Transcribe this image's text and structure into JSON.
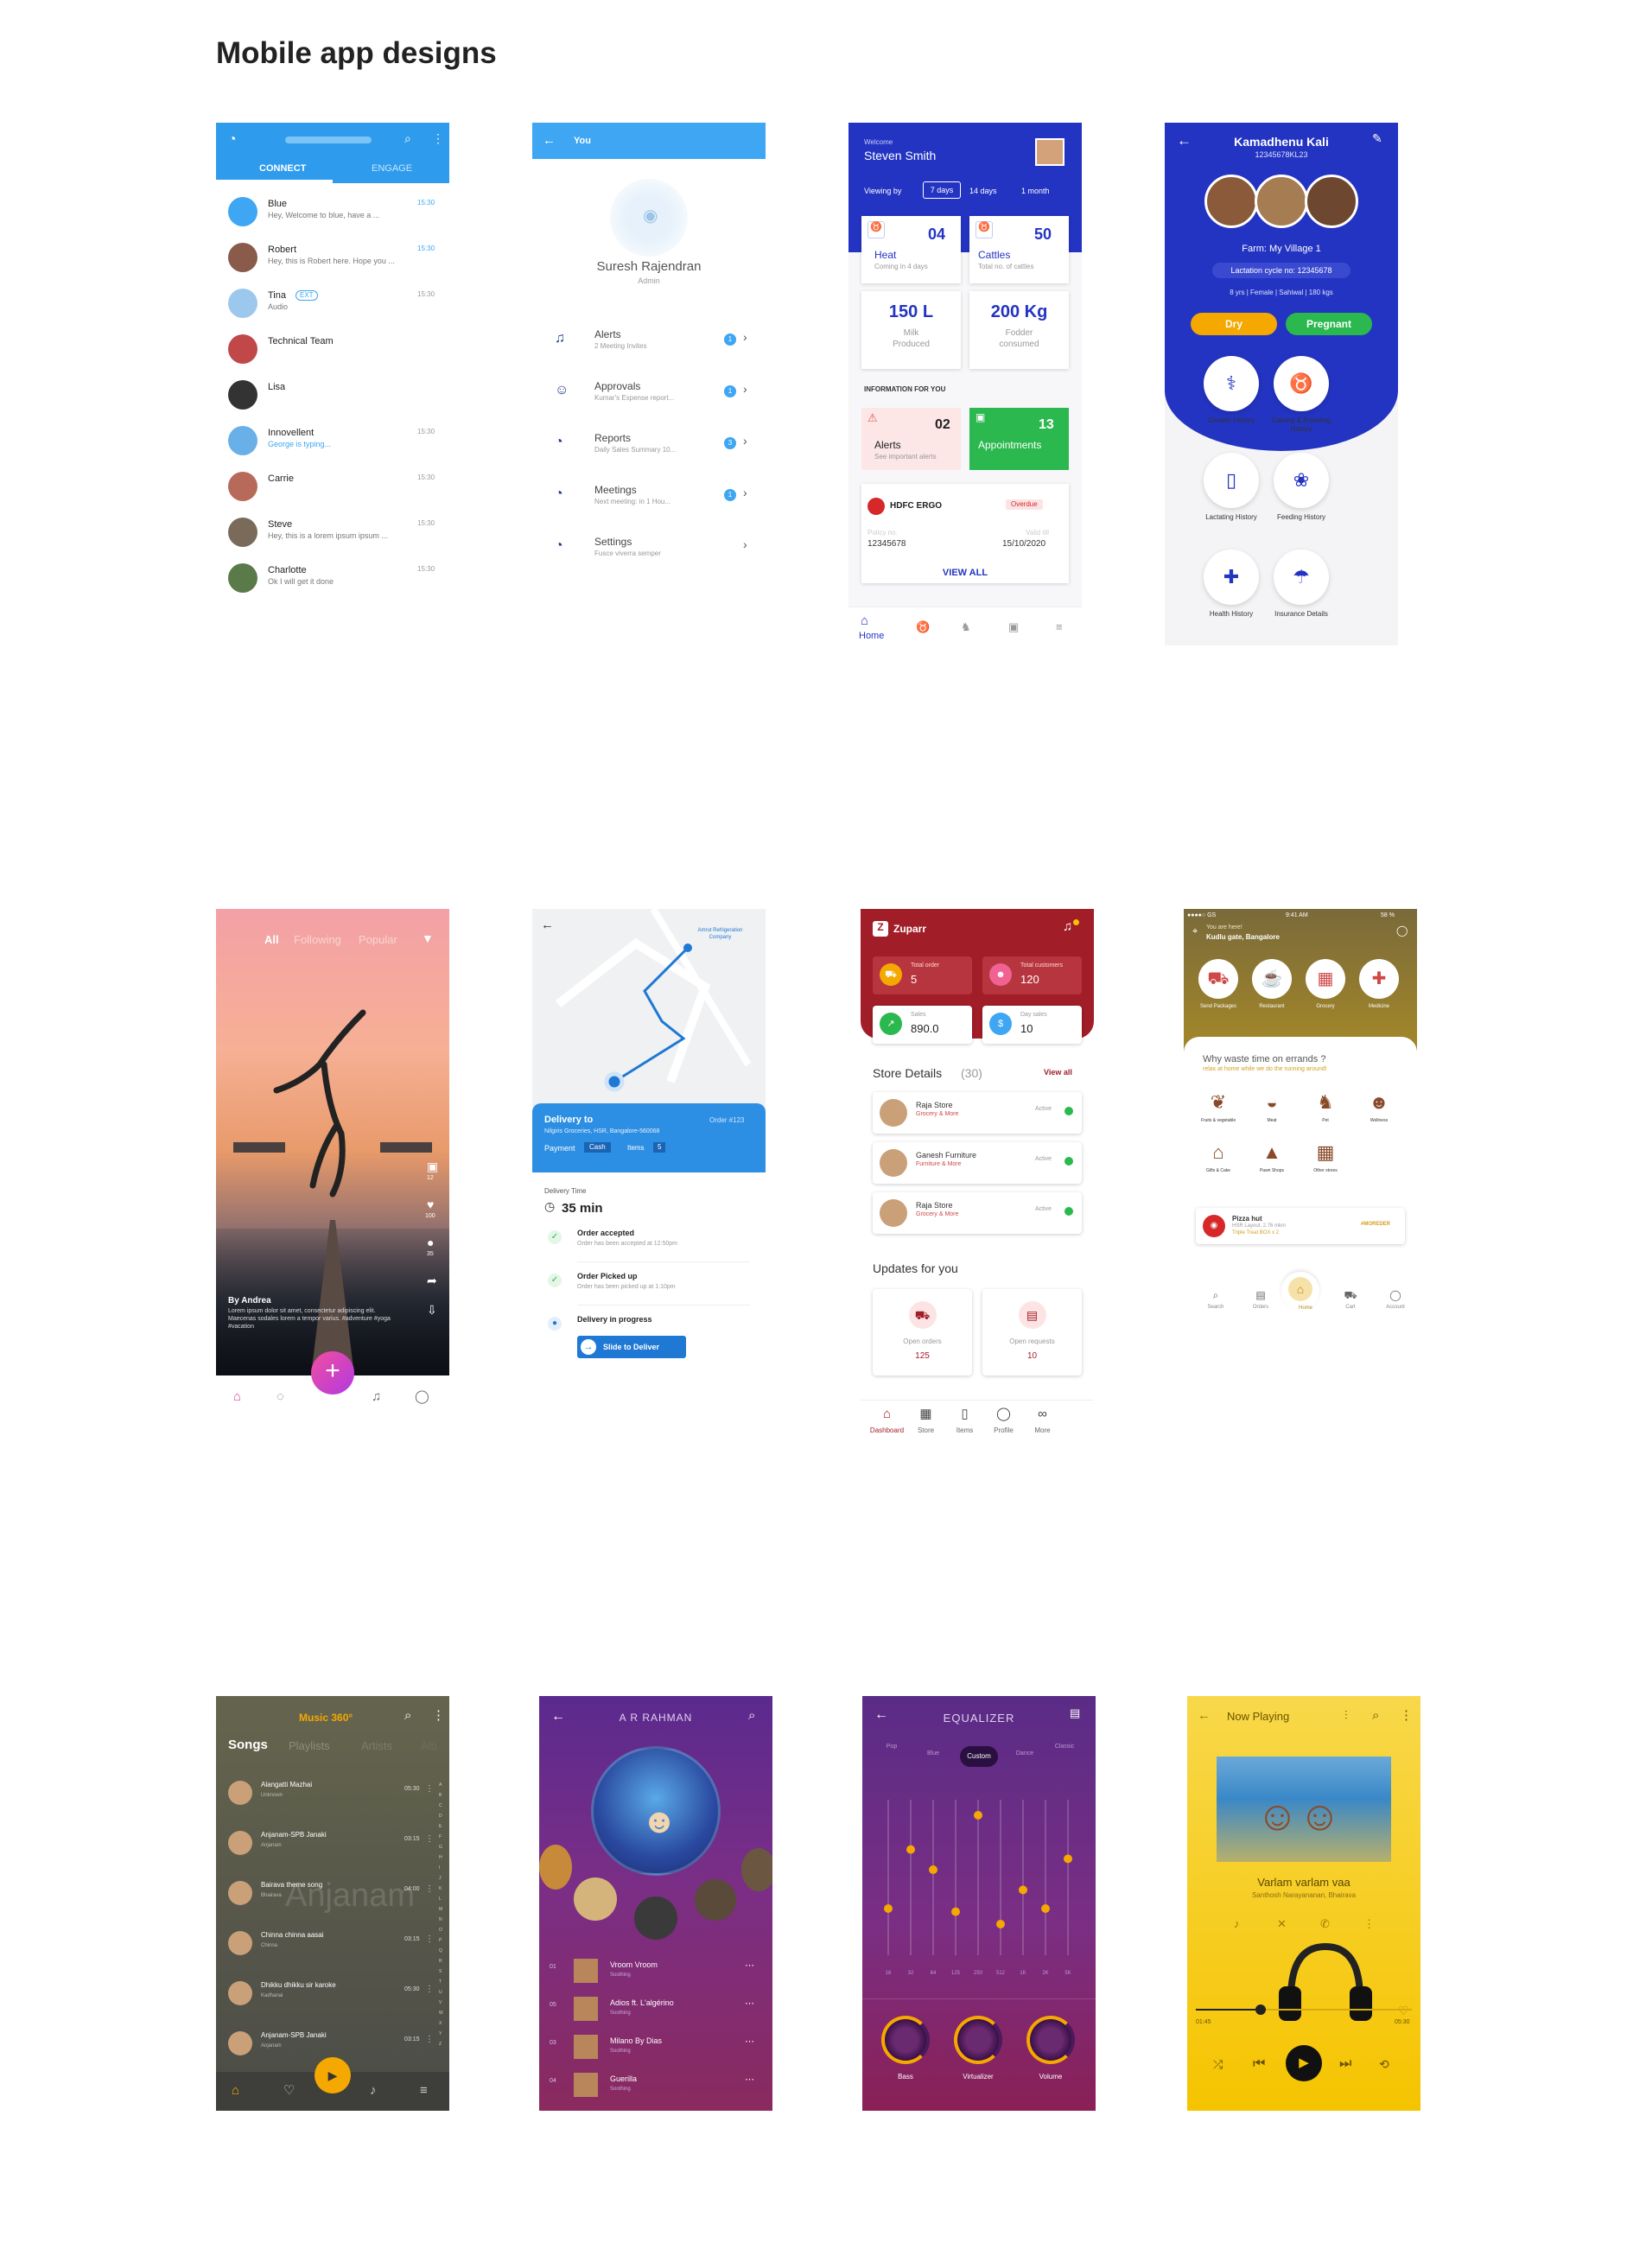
{
  "page_title": "Mobile app designs",
  "s1": {
    "tabs": [
      "CONNECT",
      "ENGAGE"
    ],
    "chats": [
      {
        "name": "Blue",
        "msg": "Hey, Welcome to blue, have a ...",
        "time": "15:30"
      },
      {
        "name": "Robert",
        "msg": "Hey, this is Robert here. Hope you ...",
        "time": "15:30"
      },
      {
        "name": "Tina",
        "tag": "EXT",
        "msg": "Audio",
        "time": "15:30"
      },
      {
        "name": "Technical Team",
        "msg": "",
        "time": ""
      },
      {
        "name": "Lisa",
        "msg": "",
        "time": ""
      },
      {
        "name": "Innovellent",
        "msg": "George is typing...",
        "time": "15:30"
      },
      {
        "name": "Carrie",
        "msg": "",
        "time": "15:30"
      },
      {
        "name": "Steve",
        "msg": "Hey, this is a lorem ipsum ipsum ...",
        "time": "15:30"
      },
      {
        "name": "Charlotte",
        "msg": "Ok I will get it done",
        "time": "15:30"
      }
    ]
  },
  "s2": {
    "header": "You",
    "name": "Suresh Rajendran",
    "role": "Admin",
    "items": [
      {
        "title": "Alerts",
        "sub": "2 Meeting Invites",
        "badge": "1"
      },
      {
        "title": "Approvals",
        "sub": "Kumar's Expense report...",
        "badge": "1"
      },
      {
        "title": "Reports",
        "sub": "Daily Sales Summary 10...",
        "badge": "3"
      },
      {
        "title": "Meetings",
        "sub": "Next meeting: in 1 Hou...",
        "badge": "1"
      },
      {
        "title": "Settings",
        "sub": "Fusce viverra semper",
        "badge": ""
      }
    ]
  },
  "s3": {
    "welcome": "Welcome",
    "user": "Steven Smith",
    "viewing": "Viewing by",
    "filters": [
      "7 days",
      "14 days",
      "1 month"
    ],
    "heat_value": "04",
    "heat_label": "Heat",
    "heat_sub": "Coming in 4 days",
    "cattle_value": "50",
    "cattle_label": "Cattles",
    "cattle_sub": "Total no. of cattles",
    "milk_value": "150 L",
    "milk_l1": "Milk",
    "milk_l2": "Produced",
    "fodder_value": "200 Kg",
    "fodder_l1": "Fodder",
    "fodder_l2": "consumed",
    "info": "INFORMATION FOR YOU",
    "alerts_value": "02",
    "alerts_label": "Alerts",
    "alerts_sub": "See important alerts",
    "appt_value": "13",
    "appt_label": "Appointments",
    "bank": "HDFC ERGO",
    "overdue": "Overdue",
    "policy_label": "Policy no.",
    "policy": "12345678",
    "valid_label": "Valid till",
    "date": "15/10/2020",
    "view_all": "VIEW ALL",
    "nav_home": "Home"
  },
  "s4": {
    "name": "Kamadhenu Kali",
    "id": "12345678KL23",
    "farm": "Farm: My Village 1",
    "cycle": "Lactation cycle no: 12345678",
    "info": "8 yrs | Female | Sahiwal | 180 kgs",
    "dry": "Dry",
    "pregnant": "Pregnant",
    "items": [
      "Genetic History",
      "Calving & Breeding History",
      "Lactating History",
      "Feeding History",
      "Health History",
      "Insurance Details"
    ]
  },
  "s5": {
    "tabs": [
      "All",
      "Following",
      "Popular"
    ],
    "author": "By Andrea",
    "caption": "Lorem ipsum dolor sit amet, consectetur adipiscing elit. Maecenas sodales lorem a tempor varius. #adventure #yoga #vacation",
    "counts": [
      "12",
      "100",
      "35"
    ]
  },
  "s6": {
    "map_label": "Amrut Refrigeration Company",
    "delivery_to": "Delivery to",
    "order_no": "Order #123",
    "address": "Nilgiris Groceries, HSR, Bangalore-560068",
    "payment_label": "Payment",
    "payment": "Cash",
    "items_label": "Items",
    "items": "5",
    "time_label": "Delivery Time",
    "time": "35 min",
    "steps": [
      {
        "title": "Order accepted",
        "sub": "Order has been accepted at 12:50pm"
      },
      {
        "title": "Order Picked up",
        "sub": "Order has been picked up at 1:10pm"
      },
      {
        "title": "Delivery in progress",
        "sub": ""
      }
    ],
    "slide": "Slide to Deliver"
  },
  "s7": {
    "brand": "Zuparr",
    "total_order_label": "Total order",
    "total_order": "5",
    "total_cust_label": "Total customers",
    "total_cust": "120",
    "sales_label": "Sales",
    "sales": "890.0",
    "day_label": "Day sales",
    "day": "10",
    "store_title": "Store Details",
    "store_count": "(30)",
    "view_all": "View all",
    "stores": [
      {
        "name": "Raja Store",
        "cat": "Grocery & More",
        "status": "Active"
      },
      {
        "name": "Ganesh Furniture",
        "cat": "Furniture & More",
        "status": "Active"
      },
      {
        "name": "Raja Store",
        "cat": "Grocery & More",
        "status": "Active"
      }
    ],
    "updates": "Updates for you",
    "open_orders_label": "Open orders",
    "open_orders": "125",
    "open_req_label": "Open requests",
    "open_req": "10",
    "nav": [
      "Dashboard",
      "Store",
      "Items",
      "Profile",
      "More"
    ]
  },
  "s8": {
    "carrier": "●●●●○ GS",
    "clock": "9:41 AM",
    "battery": "58 %",
    "here": "You are here!",
    "location": "Kudlu gate, Bangalore",
    "cats": [
      "Send Packages",
      "Restaurant",
      "Grocery",
      "Medicine"
    ],
    "promo_title": "Why waste time on errands ?",
    "promo_sub": "relax at home while we do the running around!",
    "subcats": [
      "Fruits & vegetable",
      "Meat",
      "Pet",
      "Wellness",
      "Gifts & Cake",
      "Pawn Shops",
      "Other stores"
    ],
    "shop_name": "Pizza hut",
    "shop_sub": "HSR Layout, 2.76 mkm",
    "shop_offer": "Triple Treat BOX x 2",
    "shop_code": "#MOREDER",
    "nav": [
      "Search",
      "Orders",
      "Home",
      "Cart",
      "Account"
    ]
  },
  "s9": {
    "brand": "Music 360°",
    "tabs": [
      "Songs",
      "Playlists",
      "Artists",
      "Alb"
    ],
    "watermark": "Anjanam",
    "songs": [
      {
        "t": "Alangatti Mazhai",
        "a": "Unknown",
        "d": "05:30"
      },
      {
        "t": "Anjanam-SPB Janaki",
        "a": "Anjanam",
        "d": "03:15"
      },
      {
        "t": "Bairava theme song",
        "a": "Bhairava",
        "d": "04:00"
      },
      {
        "t": "Chinna chinna aasai",
        "a": "Chinna",
        "d": "03:15"
      },
      {
        "t": "Dhikku dhikku sir karoke",
        "a": "Kadhanai",
        "d": "05:30"
      },
      {
        "t": "Anjanam-SPB Janaki",
        "a": "Anjanam",
        "d": "03:15"
      }
    ],
    "alpha": [
      "A",
      "B",
      "C",
      "D",
      "E",
      "F",
      "G",
      "H",
      "I",
      "J",
      "K",
      "L",
      "M",
      "N",
      "O",
      "P",
      "Q",
      "R",
      "S",
      "T",
      "U",
      "V",
      "W",
      "X",
      "Y",
      "Z"
    ]
  },
  "s10": {
    "title": "A R RAHMAN",
    "songs": [
      {
        "n": "01",
        "t": "Vroom Vroom",
        "s": "Soothing"
      },
      {
        "n": "05",
        "t": "Adios ft. L'algérino",
        "s": "Soothing"
      },
      {
        "n": "03",
        "t": "Milano By Dias",
        "s": "Soothing"
      },
      {
        "n": "04",
        "t": "Guerilla",
        "s": "Soothing"
      }
    ]
  },
  "s11": {
    "title": "EQUALIZER",
    "presets": [
      "Pop",
      "Blue",
      "Custom",
      "Dance",
      "Classic"
    ],
    "freqs": [
      "16",
      "32",
      "64",
      "125",
      "250",
      "512",
      "1K",
      "2K",
      "5K"
    ],
    "levels": [
      0.3,
      0.68,
      0.55,
      0.28,
      0.9,
      0.2,
      0.42,
      0.3,
      0.62
    ],
    "knobs": [
      "Bass",
      "Virtualizer",
      "Volume"
    ]
  },
  "s12": {
    "header": "Now Playing",
    "song": "Varlam varlam vaa",
    "artist": "Santhosh Narayananan, Bhairava",
    "elapsed": "01:45",
    "total": "05:30",
    "progress": 0.3
  }
}
